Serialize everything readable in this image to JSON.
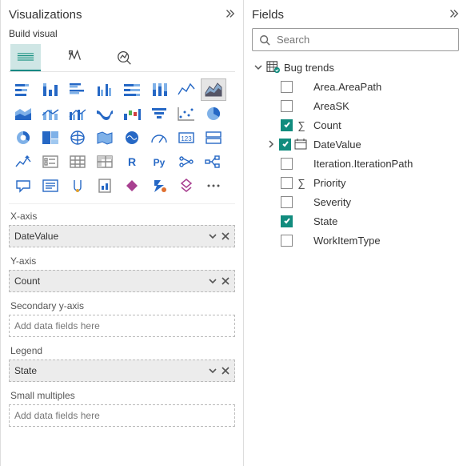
{
  "visualizations": {
    "title": "Visualizations",
    "build_label": "Build visual",
    "gallery_items": [
      {
        "name": "stacked-bar-h",
        "sel": false
      },
      {
        "name": "stacked-bar-v",
        "sel": false
      },
      {
        "name": "clustered-bar-h",
        "sel": false
      },
      {
        "name": "clustered-bar-v",
        "sel": false
      },
      {
        "name": "100-stacked-bar-h",
        "sel": false
      },
      {
        "name": "100-stacked-bar-v",
        "sel": false
      },
      {
        "name": "line-chart",
        "sel": false
      },
      {
        "name": "area-chart",
        "sel": true
      },
      {
        "name": "stacked-area",
        "sel": false
      },
      {
        "name": "line-stacked-column",
        "sel": false
      },
      {
        "name": "line-clustered-column",
        "sel": false
      },
      {
        "name": "ribbon-chart",
        "sel": false
      },
      {
        "name": "waterfall",
        "sel": false
      },
      {
        "name": "funnel",
        "sel": false
      },
      {
        "name": "scatter",
        "sel": false
      },
      {
        "name": "pie",
        "sel": false
      },
      {
        "name": "donut",
        "sel": false
      },
      {
        "name": "treemap",
        "sel": false
      },
      {
        "name": "map",
        "sel": false
      },
      {
        "name": "filled-map",
        "sel": false
      },
      {
        "name": "azure-map",
        "sel": false
      },
      {
        "name": "gauge",
        "sel": false
      },
      {
        "name": "card",
        "sel": false
      },
      {
        "name": "multi-row-card",
        "sel": false
      },
      {
        "name": "kpi",
        "sel": false
      },
      {
        "name": "slicer",
        "sel": false
      },
      {
        "name": "table",
        "sel": false
      },
      {
        "name": "matrix",
        "sel": false
      },
      {
        "name": "r-visual",
        "sel": false
      },
      {
        "name": "py-visual",
        "sel": false
      },
      {
        "name": "key-influencers",
        "sel": false
      },
      {
        "name": "decomposition-tree",
        "sel": false
      },
      {
        "name": "qa-visual",
        "sel": false
      },
      {
        "name": "smart-narrative",
        "sel": false
      },
      {
        "name": "goals",
        "sel": false
      },
      {
        "name": "paginated-report",
        "sel": false
      },
      {
        "name": "power-apps",
        "sel": false
      },
      {
        "name": "power-automate",
        "sel": false
      },
      {
        "name": "get-more-visuals",
        "sel": false
      },
      {
        "name": "more-options",
        "sel": false
      }
    ],
    "wells": {
      "xaxis": {
        "label": "X-axis",
        "value": "DateValue",
        "filled": true
      },
      "yaxis": {
        "label": "Y-axis",
        "value": "Count",
        "filled": true
      },
      "secondary": {
        "label": "Secondary y-axis",
        "value": "Add data fields here",
        "filled": false
      },
      "legend": {
        "label": "Legend",
        "value": "State",
        "filled": true
      },
      "small": {
        "label": "Small multiples",
        "value": "Add data fields here",
        "filled": false
      }
    }
  },
  "fields": {
    "title": "Fields",
    "search_placeholder": "Search",
    "table": "Bug trends",
    "items": [
      {
        "name": "Area.AreaPath",
        "checked": false,
        "icon": "none",
        "expand": false
      },
      {
        "name": "AreaSK",
        "checked": false,
        "icon": "none",
        "expand": false
      },
      {
        "name": "Count",
        "checked": true,
        "icon": "sigma",
        "expand": false
      },
      {
        "name": "DateValue",
        "checked": true,
        "icon": "calendar",
        "expand": true
      },
      {
        "name": "Iteration.IterationPath",
        "checked": false,
        "icon": "none",
        "expand": false
      },
      {
        "name": "Priority",
        "checked": false,
        "icon": "sigma",
        "expand": false
      },
      {
        "name": "Severity",
        "checked": false,
        "icon": "none",
        "expand": false
      },
      {
        "name": "State",
        "checked": true,
        "icon": "none",
        "expand": false
      },
      {
        "name": "WorkItemType",
        "checked": false,
        "icon": "none",
        "expand": false
      }
    ]
  }
}
